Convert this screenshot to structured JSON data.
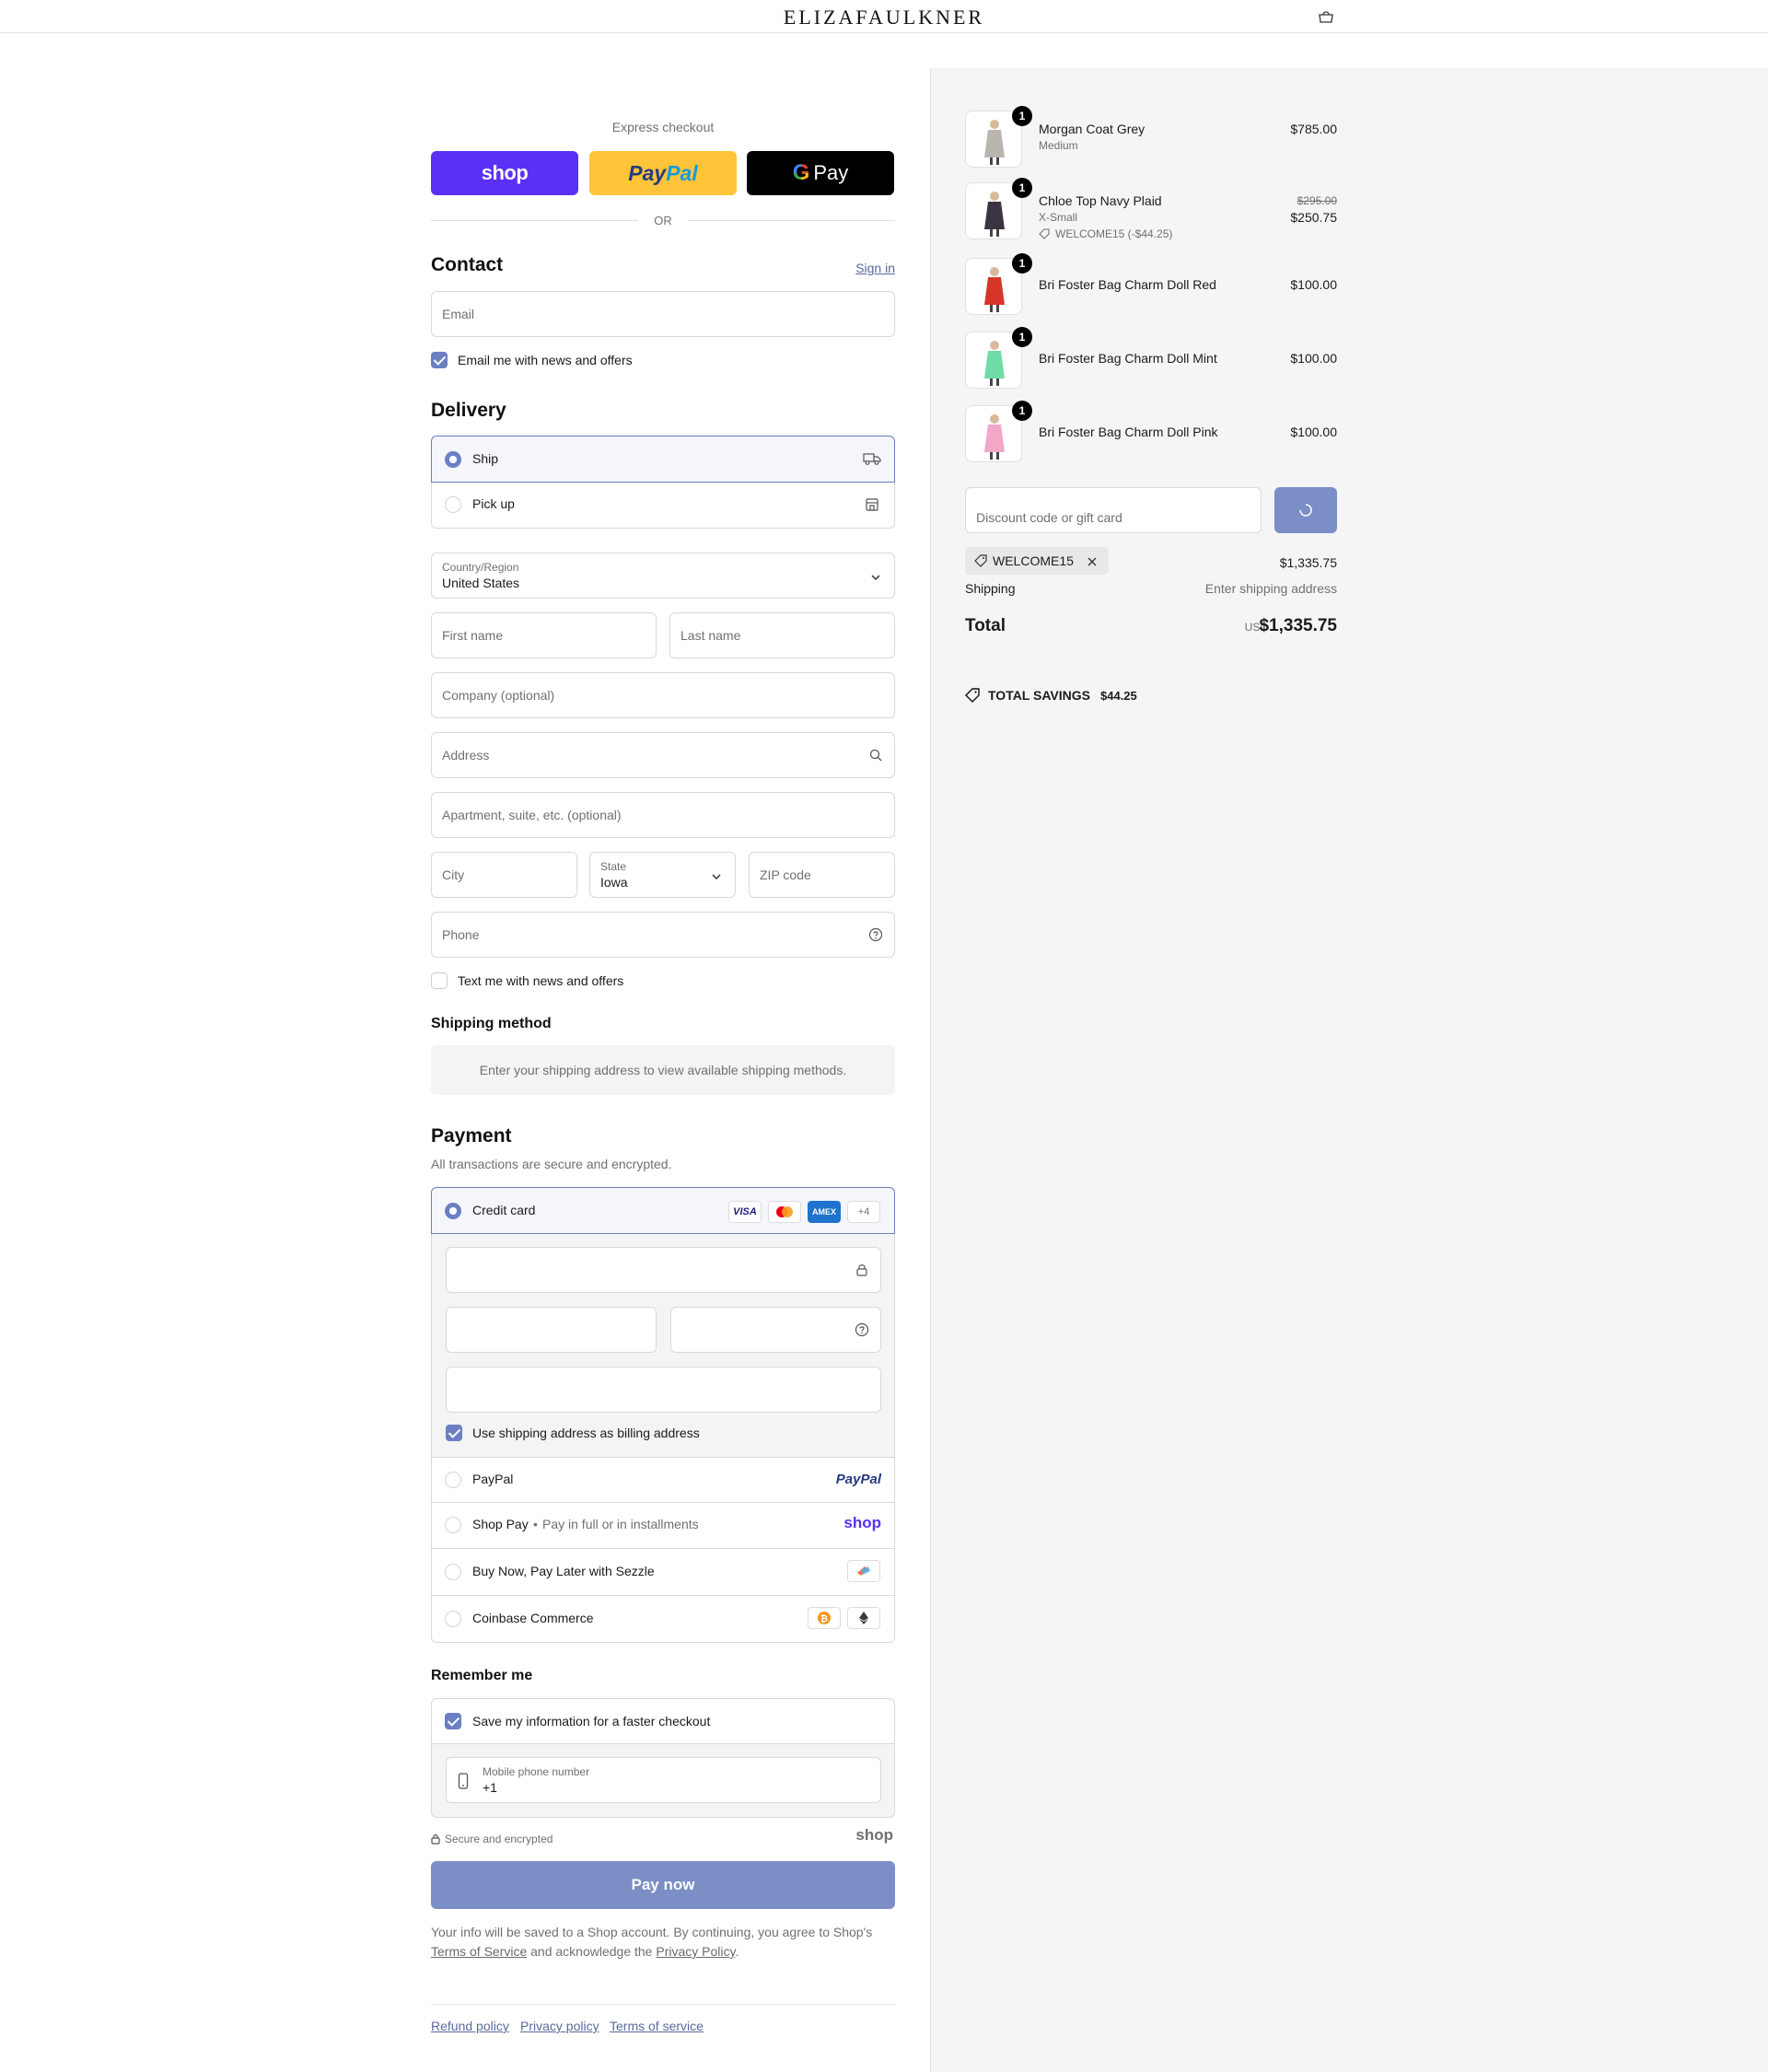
{
  "header": {
    "brand": "ELIZAFAULKNER",
    "bag_icon": "bag-icon"
  },
  "express": {
    "title": "Express checkout",
    "shop_label": "shop",
    "paypal_part1": "Pay",
    "paypal_part2": "Pal",
    "gpay_g": "G",
    "gpay_label": "Pay",
    "or_label": "OR"
  },
  "contact": {
    "title": "Contact",
    "sign_in": "Sign in",
    "email_placeholder": "Email",
    "email_optin_label": "Email me with news and offers",
    "email_optin_checked": true
  },
  "delivery": {
    "title": "Delivery",
    "options": [
      {
        "label": "Ship",
        "selected": true,
        "icon": "truck-icon"
      },
      {
        "label": "Pick up",
        "selected": false,
        "icon": "store-icon"
      }
    ],
    "country_label": "Country/Region",
    "country_value": "United States",
    "first_name_placeholder": "First name",
    "last_name_placeholder": "Last name",
    "company_placeholder": "Company (optional)",
    "address_placeholder": "Address",
    "apartment_placeholder": "Apartment, suite, etc. (optional)",
    "city_placeholder": "City",
    "state_label": "State",
    "state_value": "Iowa",
    "zip_placeholder": "ZIP code",
    "phone_placeholder": "Phone",
    "sms_optin_label": "Text me with news and offers",
    "sms_optin_checked": false
  },
  "shipping_method": {
    "title": "Shipping method",
    "notice": "Enter your shipping address to view available shipping methods."
  },
  "payment": {
    "title": "Payment",
    "subtitle": "All transactions are secure and encrypted.",
    "credit_card_label": "Credit card",
    "card_badges": [
      "VISA",
      "AMEX",
      "+4"
    ],
    "billing_same_label": "Use shipping address as billing address",
    "billing_same_checked": true,
    "methods": [
      {
        "label": "PayPal",
        "logo": "PayPal"
      },
      {
        "label": "Shop Pay",
        "sub": "Pay in full or in installments",
        "logo": "shop"
      },
      {
        "label": "Buy Now, Pay Later with Sezzle"
      },
      {
        "label": "Coinbase Commerce"
      }
    ]
  },
  "remember": {
    "title": "Remember me",
    "save_label": "Save my information for a faster checkout",
    "save_checked": true,
    "mobile_label": "Mobile phone number",
    "mobile_value": "+1",
    "secure_label": "Secure and encrypted",
    "shop_logo": "shop"
  },
  "pay_now_label": "Pay now",
  "legal": {
    "line1": "Your info will be saved to a Shop account. By continuing, you agree to Shop's",
    "tos": "Terms of Service",
    "and_ack": "and acknowledge the",
    "privacy": "Privacy Policy",
    "period": "."
  },
  "footer_links": [
    "Refund policy",
    "Privacy policy",
    "Terms of service"
  ],
  "summary": {
    "items": [
      {
        "name": "Morgan Coat Grey",
        "variant": "Medium",
        "qty": "1",
        "price": "$785.00",
        "color": "#b9b6b0"
      },
      {
        "name": "Chloe Top Navy Plaid",
        "variant": "X-Small",
        "discount": "WELCOME15 (-$44.25)",
        "qty": "1",
        "old_price": "$295.00",
        "price": "$250.75",
        "color": "#3b3442"
      },
      {
        "name": "Bri Foster Bag Charm Doll Red",
        "qty": "1",
        "price": "$100.00",
        "color": "#d8352a"
      },
      {
        "name": "Bri Foster Bag Charm Doll Mint",
        "qty": "1",
        "price": "$100.00",
        "color": "#6fdba6"
      },
      {
        "name": "Bri Foster Bag Charm Doll Pink",
        "qty": "1",
        "price": "$100.00",
        "color": "#f2a6c8"
      }
    ],
    "discount_placeholder": "Discount code or gift card",
    "applied_code": "WELCOME15",
    "subtotal": "$1,335.75",
    "shipping_label": "Shipping",
    "shipping_value": "Enter shipping address",
    "total_label": "Total",
    "currency": "USD",
    "total_value": "$1,335.75",
    "savings_label": "TOTAL SAVINGS",
    "savings_value": "$44.25"
  }
}
